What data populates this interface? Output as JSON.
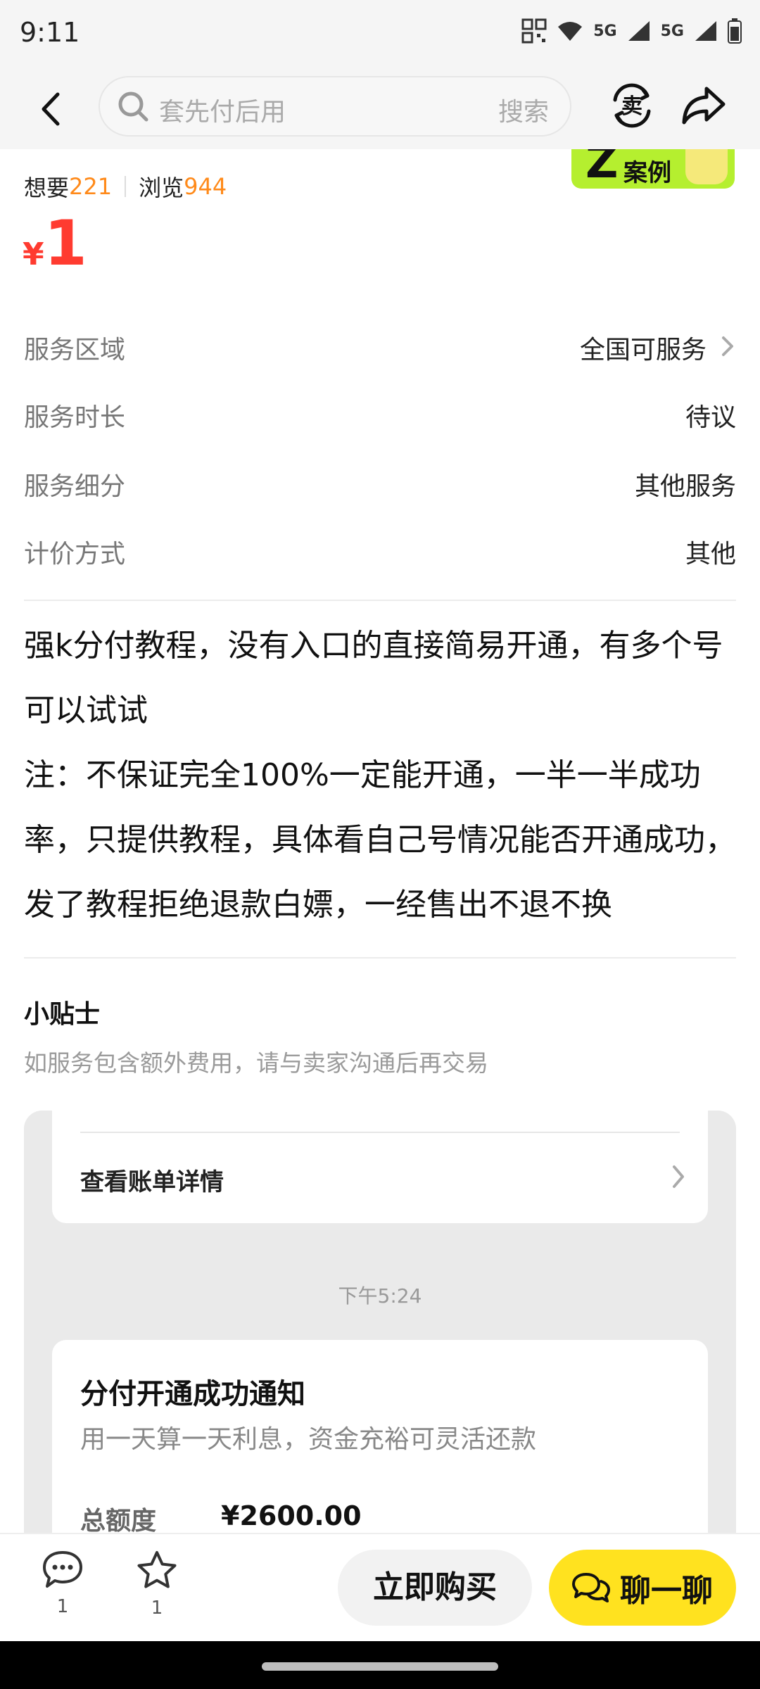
{
  "status_bar": {
    "time": "9:11",
    "signal_1": "5G",
    "signal_2": "5G"
  },
  "top_nav": {
    "search_placeholder": "套先付后用",
    "search_button": "搜索",
    "sell_icon_glyph": "卖"
  },
  "item": {
    "want_label": "想要",
    "want_count": "221",
    "view_label": "浏览",
    "view_count": "944",
    "badge_text": "案例",
    "currency": "¥",
    "price": "1"
  },
  "attributes": [
    {
      "label": "服务区域",
      "value": "全国可服务"
    },
    {
      "label": "服务时长",
      "value": "待议"
    },
    {
      "label": "服务细分",
      "value": "其他服务"
    },
    {
      "label": "计价方式",
      "value": "其他"
    }
  ],
  "description": {
    "para1": "强k分付教程，没有入口的直接简易开通，有多个号可以试试",
    "para2": "注：不保证完全100%一定能开通，一半一半成功率，只提供教程，具体看自己号情况能否开通成功，发了教程拒绝退款白嫖，一经售出不退不换"
  },
  "tips": {
    "title": "小贴士",
    "text": "如服务包含额外费用，请与卖家沟通后再交易"
  },
  "screenshot": {
    "bill_label": "查看账单详情",
    "chat_time": "下午5:24",
    "notice_title": "分付开通成功通知",
    "notice_sub": "用一天算一天利息，资金充裕可灵活还款",
    "quota_label": "总额度",
    "quota_value": "¥2600.00"
  },
  "bottom_bar": {
    "comment_count": "1",
    "favorite_count": "1",
    "buy_label": "立即购买",
    "chat_label": "聊一聊"
  },
  "colors": {
    "price": "#ff3b30",
    "stat_number": "#ff8a1a",
    "chat_button": "#ffe21f",
    "badge": "#b5ef2f"
  }
}
